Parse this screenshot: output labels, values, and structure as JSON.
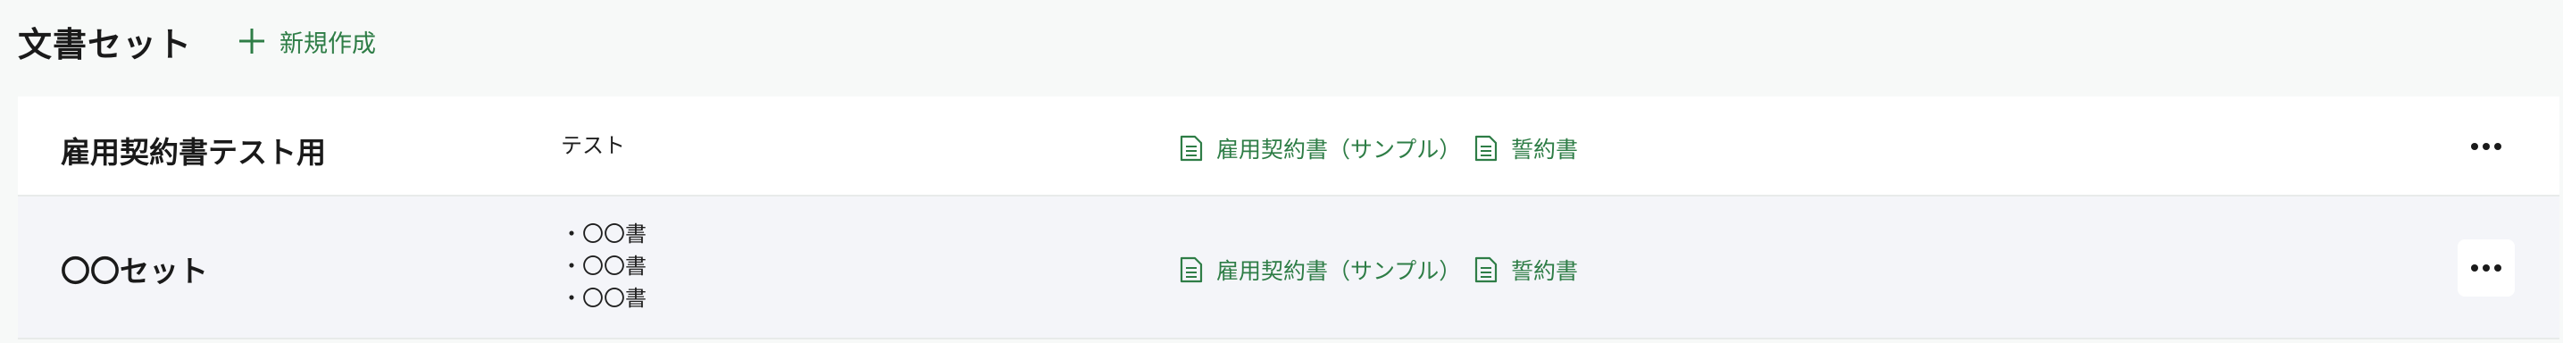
{
  "header": {
    "title": "文書セット",
    "new_button_label": "新規作成"
  },
  "rows": [
    {
      "name": "雇用契約書テスト用",
      "description": [
        "テスト"
      ],
      "documents": [
        "雇用契約書（サンプル）",
        "誓約書"
      ]
    },
    {
      "name": "〇〇セット",
      "description": [
        "・〇〇書",
        "・〇〇書",
        "・〇〇書"
      ],
      "documents": [
        "雇用契約書（サンプル）",
        "誓約書"
      ]
    }
  ],
  "icons": {
    "new": "plus-icon",
    "document": "document-icon",
    "more": "more-options-icon"
  },
  "colors": {
    "accent": "#2e7d46",
    "background": "#f7f9f8",
    "row_hover": "#f4f5f9"
  }
}
